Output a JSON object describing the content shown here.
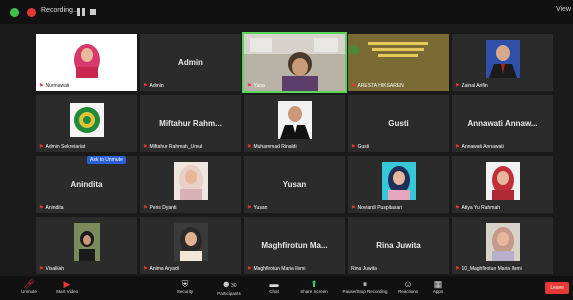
{
  "topbar": {
    "recording_label": "Recording...",
    "view_label": "View"
  },
  "tiles": [
    {
      "name": "Nurmawati",
      "big": ""
    },
    {
      "name": "Admin",
      "big": "Admin"
    },
    {
      "name": "Yana",
      "big": ""
    },
    {
      "name": "ARESTA HIKSAREN",
      "big": ""
    },
    {
      "name": "Zainal Arifin",
      "big": ""
    },
    {
      "name": "Admin Sekretariat",
      "big": ""
    },
    {
      "name": "Miftahur Rahmah_Umul",
      "big": "Miftahur Rahm..."
    },
    {
      "name": "Muhammad Rinaldi",
      "big": ""
    },
    {
      "name": "Gusti",
      "big": "Gusti"
    },
    {
      "name": "Annawati Annawati",
      "big": "Annawati Annaw..."
    },
    {
      "name": "Anindita",
      "big": "Anindita"
    },
    {
      "name": "Peris Dyanti",
      "big": ""
    },
    {
      "name": "Yusan",
      "big": "Yusan"
    },
    {
      "name": "Noviardi Puspitasari",
      "big": ""
    },
    {
      "name": "Atiya Yu Rahmah",
      "big": ""
    },
    {
      "name": "Visalilah",
      "big": ""
    },
    {
      "name": "Anima Aryadi",
      "big": ""
    },
    {
      "name": "Maghfirotun Maria Ilsmi",
      "big": "Maghfirotun Ma..."
    },
    {
      "name": "Rina Juwita",
      "big": "Rina Juwita"
    },
    {
      "name": "10_Maghfirotun Maria Ilsmi",
      "big": ""
    }
  ],
  "rename_badge": "Ask to Unmute",
  "toolbar": {
    "unmute": "Unmute",
    "start_video": "Start Video",
    "security": "Security",
    "participants": "Participants",
    "participants_count": "30",
    "chat": "Chat",
    "share_screen": "Share Screen",
    "recording": "Pause/Stop Recording",
    "reactions": "Reactions",
    "apps": "Apps",
    "leave": "Leave"
  },
  "colors": {
    "active_border": "#5ad45a",
    "leave": "#e53935",
    "share": "#2ecc71",
    "rename": "#2d5fd6"
  }
}
